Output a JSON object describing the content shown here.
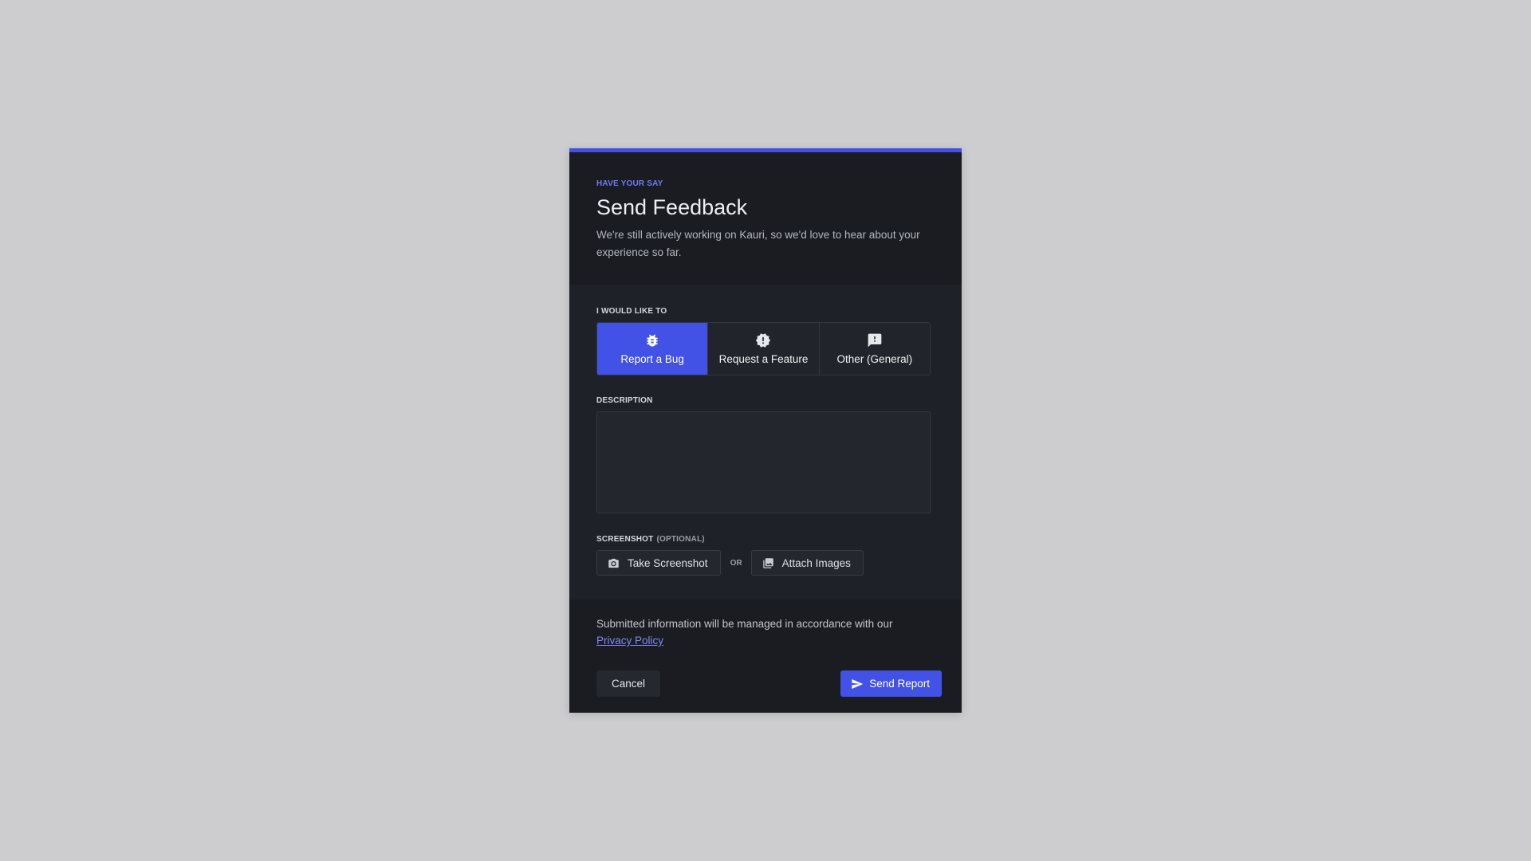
{
  "header": {
    "eyebrow": "HAVE YOUR SAY",
    "title": "Send Feedback",
    "subtitle": "We're still actively working on Kauri, so we'd love to hear about your experience so far."
  },
  "form": {
    "type_label": "I WOULD LIKE TO",
    "types": [
      {
        "label": "Report a Bug",
        "icon": "bug-icon",
        "selected": true
      },
      {
        "label": "Request a Feature",
        "icon": "new-badge-icon",
        "selected": false
      },
      {
        "label": "Other (General)",
        "icon": "feedback-icon",
        "selected": false
      }
    ],
    "description_label": "DESCRIPTION",
    "description_value": "",
    "screenshot_label": "SCREENSHOT",
    "screenshot_optional": "(OPTIONAL)",
    "take_screenshot": "Take Screenshot",
    "or": "OR",
    "attach_images": "Attach Images"
  },
  "footer": {
    "legal_text": "Submitted information will be managed in accordance with our",
    "privacy_link": "Privacy Policy",
    "cancel": "Cancel",
    "send": "Send Report"
  },
  "colors": {
    "accent": "#4251e6",
    "background": "#cdcdcf",
    "modal": "#1a1c22"
  }
}
